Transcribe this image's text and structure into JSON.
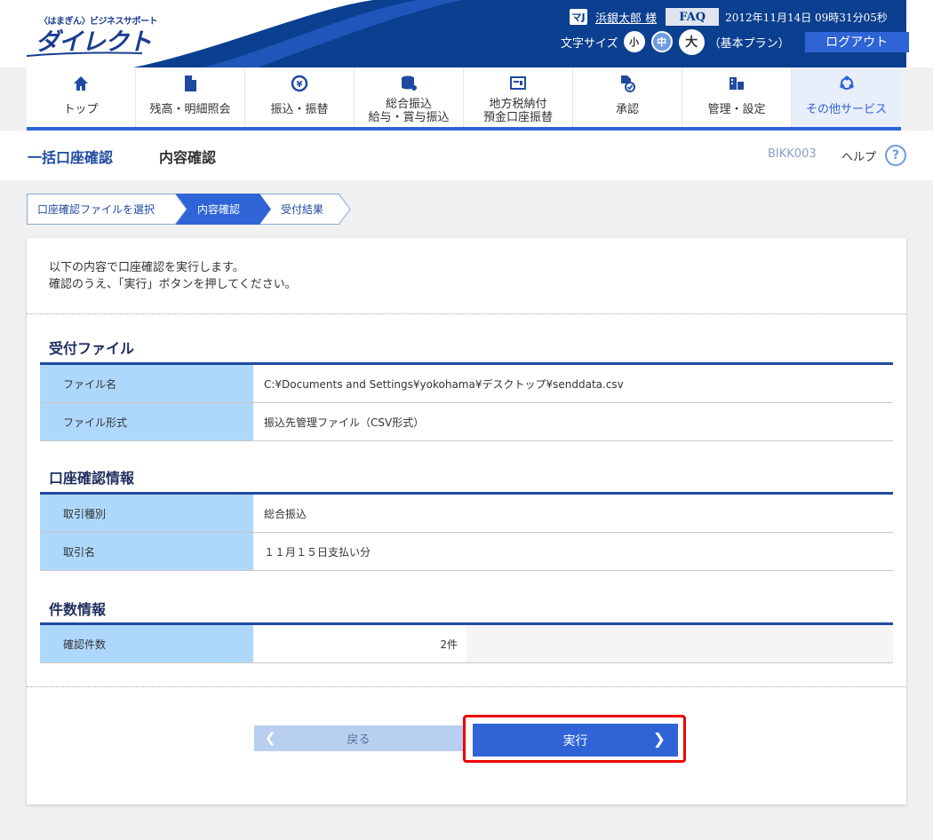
{
  "header": {
    "brand_top": "〈はまぎん〉ビジネスサポート",
    "brand_main": "ダイレクト",
    "user_icon": "マJ",
    "user_name": "浜銀太郎 様",
    "faq": "FAQ",
    "datetime": "2012年11月14日 09時31分05秒",
    "font_size_label": "文字サイズ",
    "font_small": "小",
    "font_mid": "中",
    "font_large": "大",
    "plan": "（基本プラン）",
    "logout": "ログアウト"
  },
  "nav": [
    {
      "icon": "home-icon",
      "label1": "トップ",
      "label2": ""
    },
    {
      "icon": "document-icon",
      "label1": "残高・明細照会",
      "label2": ""
    },
    {
      "icon": "yen-transfer-icon",
      "label1": "振込・振替",
      "label2": ""
    },
    {
      "icon": "coins-icon",
      "label1": "総合振込",
      "label2": "給与・賞与振込"
    },
    {
      "icon": "tax-icon",
      "label1": "地方税納付",
      "label2": "預金口座振替"
    },
    {
      "icon": "approve-icon",
      "label1": "承認",
      "label2": ""
    },
    {
      "icon": "settings-icon",
      "label1": "管理・設定",
      "label2": ""
    },
    {
      "icon": "other-services-icon",
      "label1": "その他サービス",
      "label2": ""
    }
  ],
  "title": {
    "main": "一括口座確認",
    "sub": "内容確認",
    "code": "BIKK003",
    "help": "ヘルプ"
  },
  "steps": [
    "口座確認ファイルを選択",
    "内容確認",
    "受付結果"
  ],
  "intro": {
    "line1": "以下の内容で口座確認を実行します。",
    "line2": "確認のうえ、「実行」ボタンを押してください。"
  },
  "file_section": {
    "title": "受付ファイル",
    "rows": [
      {
        "label": "ファイル名",
        "value": "C:¥Documents and Settings¥yokohama¥デスクトップ¥senddata.csv"
      },
      {
        "label": "ファイル形式",
        "value": "振込先管理ファイル（CSV形式）"
      }
    ]
  },
  "account_section": {
    "title": "口座確認情報",
    "rows": [
      {
        "label": "取引種別",
        "value": "総合振込"
      },
      {
        "label": "取引名",
        "value": "１１月１５日支払い分"
      }
    ]
  },
  "count_section": {
    "title": "件数情報",
    "label": "確認件数",
    "value": "2件"
  },
  "buttons": {
    "back": "戻る",
    "execute": "実行"
  }
}
